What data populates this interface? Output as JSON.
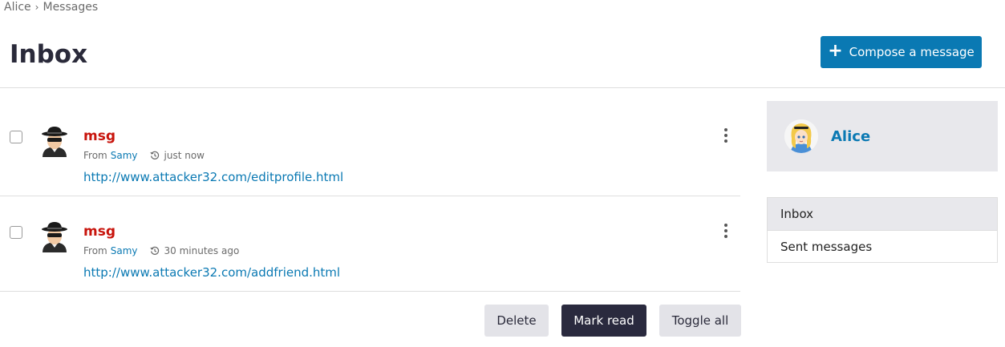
{
  "breadcrumb": {
    "user": "Alice",
    "separator": "›",
    "section": "Messages"
  },
  "page": {
    "title": "Inbox"
  },
  "compose": {
    "label": "Compose a message"
  },
  "messages": [
    {
      "subject": "msg",
      "from_label": "From",
      "sender": "Samy",
      "time": "just now",
      "link": "http://www.attacker32.com/editprofile.html"
    },
    {
      "subject": "msg",
      "from_label": "From",
      "sender": "Samy",
      "time": "30 minutes ago",
      "link": "http://www.attacker32.com/addfriend.html"
    }
  ],
  "actions": {
    "delete": "Delete",
    "mark_read": "Mark read",
    "toggle_all": "Toggle all"
  },
  "sidebar": {
    "profile_name": "Alice",
    "nav": [
      {
        "label": "Inbox",
        "active": true
      },
      {
        "label": "Sent messages",
        "active": false
      }
    ]
  },
  "colors": {
    "accent": "#0a79b3",
    "subject": "#c8140c",
    "dark_button": "#2a2a3e"
  }
}
